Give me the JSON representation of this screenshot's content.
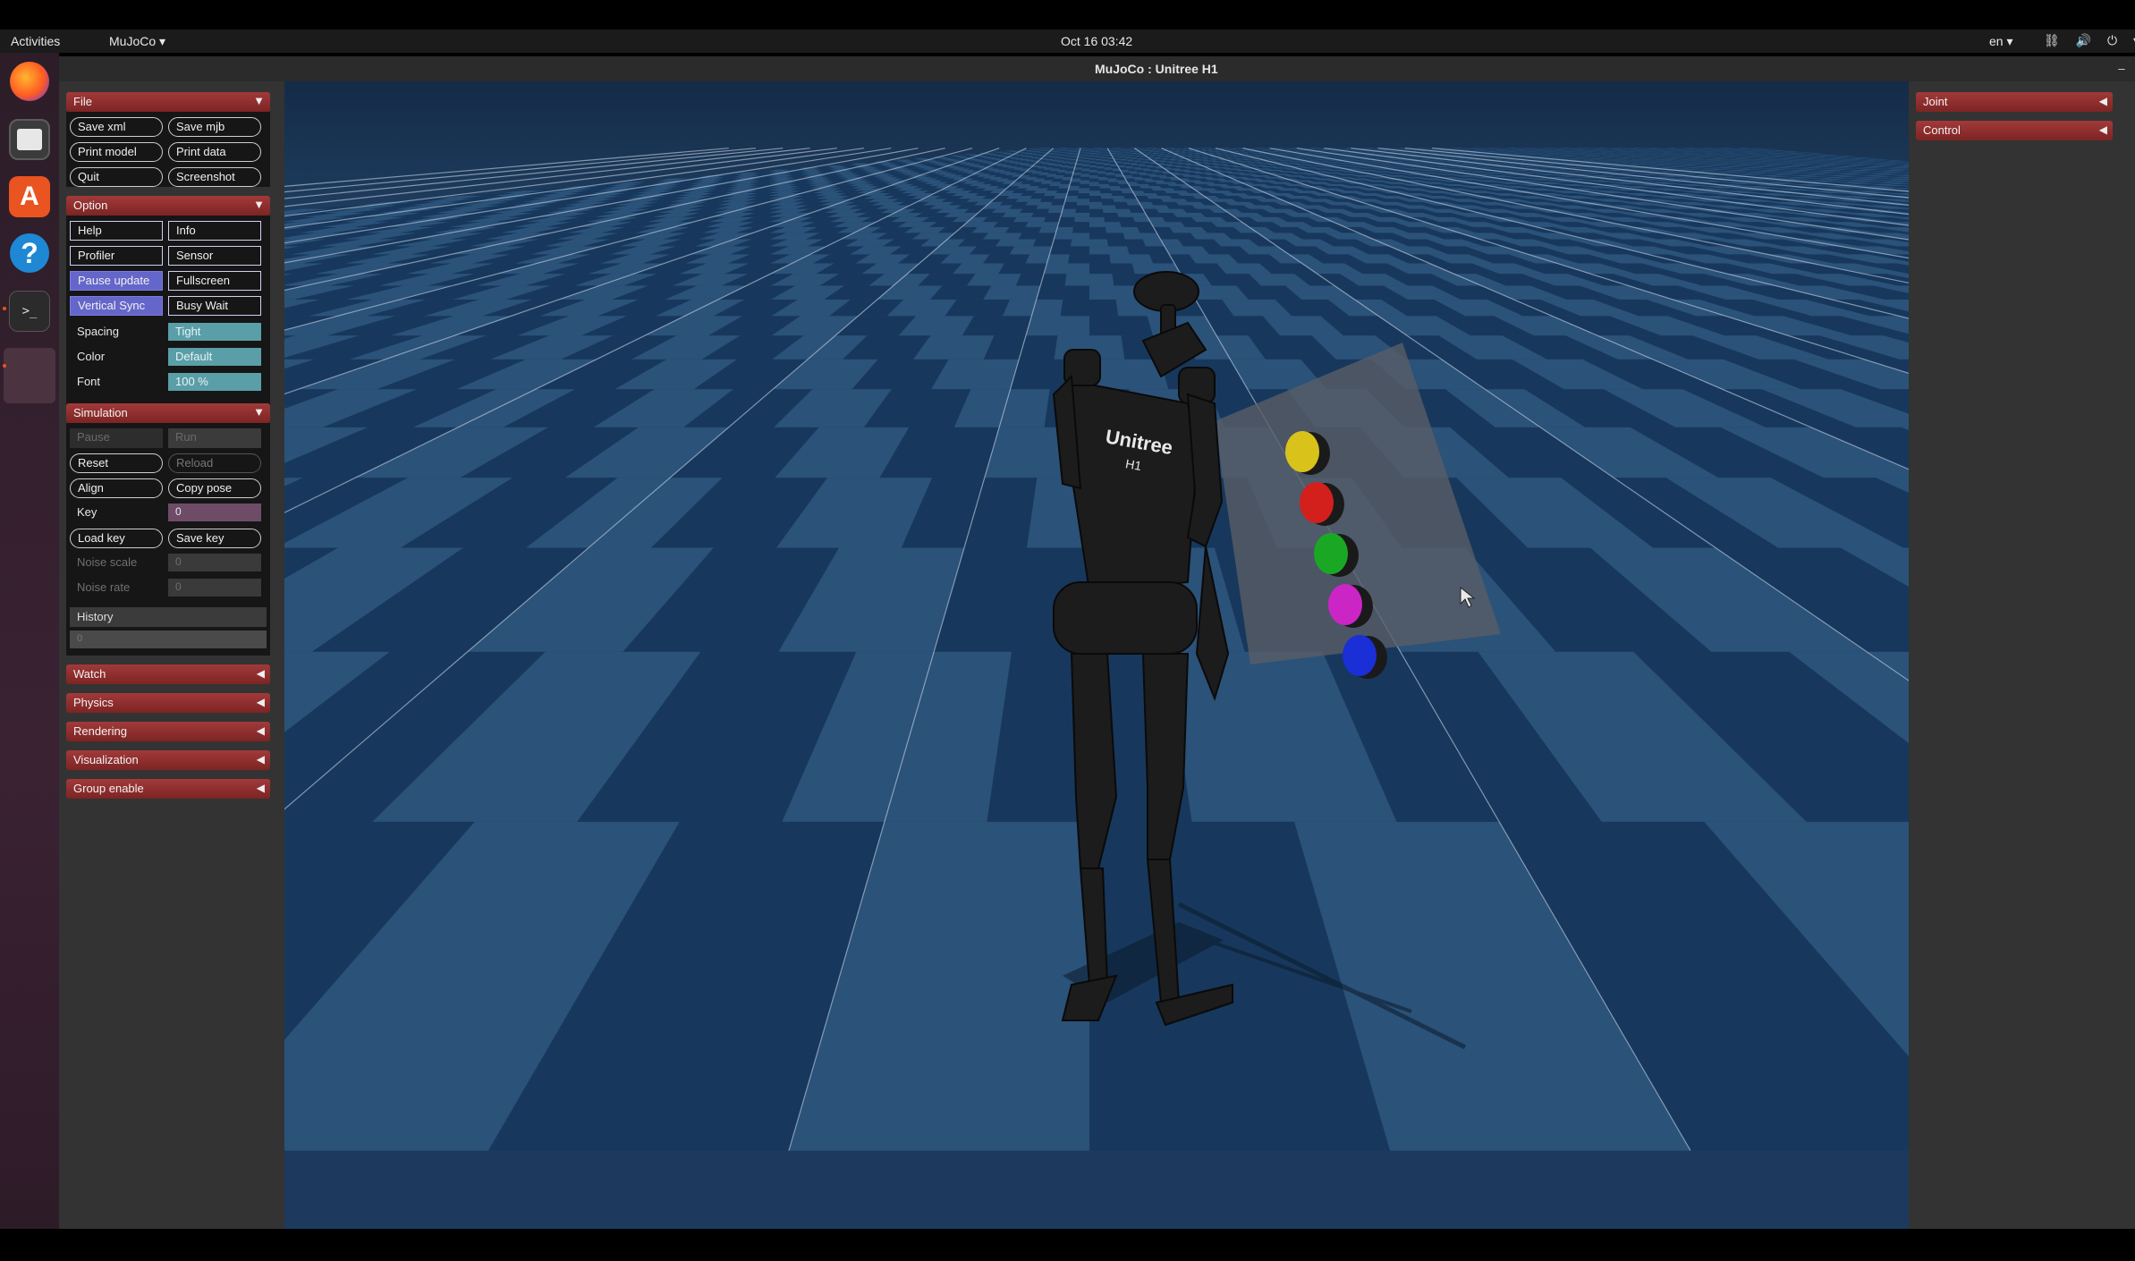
{
  "topbar": {
    "activities": "Activities",
    "app_menu": "MuJoCo ▾",
    "clock": "Oct 16  03:42",
    "language": "en ▾",
    "status_icons": "⛓ 🔊 ⏻ ▾"
  },
  "dock": {
    "items": [
      "firefox-icon",
      "files-icon",
      "software-icon",
      "help-icon",
      "terminal-icon",
      "mujoco-window-icon"
    ],
    "software_glyph": "A",
    "help_glyph": "?",
    "terminal_glyph": ">_"
  },
  "window": {
    "title": "MuJoCo : Unitree H1",
    "min": "–",
    "max": "▫",
    "close": "✕"
  },
  "left_panel": {
    "file": {
      "header": "File",
      "arrow": "▼",
      "buttons": [
        "Save xml",
        "Save mjb",
        "Print model",
        "Print data",
        "Quit",
        "Screenshot"
      ]
    },
    "option": {
      "header": "Option",
      "arrow": "▼",
      "checks": [
        {
          "label": "Help",
          "on": false
        },
        {
          "label": "Info",
          "on": false
        },
        {
          "label": "Profiler",
          "on": false
        },
        {
          "label": "Sensor",
          "on": false
        },
        {
          "label": "Pause update",
          "on": true
        },
        {
          "label": "Fullscreen",
          "on": false
        },
        {
          "label": "Vertical Sync",
          "on": true
        },
        {
          "label": "Busy Wait",
          "on": false
        }
      ],
      "spacing_label": "Spacing",
      "spacing_value": "Tight",
      "color_label": "Color",
      "color_value": "Default",
      "font_label": "Font",
      "font_value": "100 %"
    },
    "simulation": {
      "header": "Simulation",
      "arrow": "▼",
      "pause": "Pause",
      "run": "Run",
      "reset": "Reset",
      "reload": "Reload",
      "align": "Align",
      "copy_pose": "Copy pose",
      "key_label": "Key",
      "key_value": "0",
      "load_key": "Load key",
      "save_key": "Save key",
      "noise_scale_label": "Noise scale",
      "noise_scale_value": "0",
      "noise_rate_label": "Noise rate",
      "noise_rate_value": "0",
      "history_label": "History",
      "history_value": "0"
    },
    "collapsed_sections": [
      "Watch",
      "Physics",
      "Rendering",
      "Visualization",
      "Group enable"
    ],
    "collapsed_arrow": "◀"
  },
  "right_panel": {
    "sections": [
      "Joint",
      "Control"
    ],
    "arrow": "◀"
  },
  "scene": {
    "robot_label_line1": "Unitree",
    "robot_label_line2": "H1",
    "button_colors": [
      "#d9c21a",
      "#d3201c",
      "#1aa824",
      "#cc25c6",
      "#1a2fd6"
    ],
    "floor_color_a": "#2b5279",
    "floor_color_b": "#17385c",
    "board_color": "#5a5e66"
  }
}
